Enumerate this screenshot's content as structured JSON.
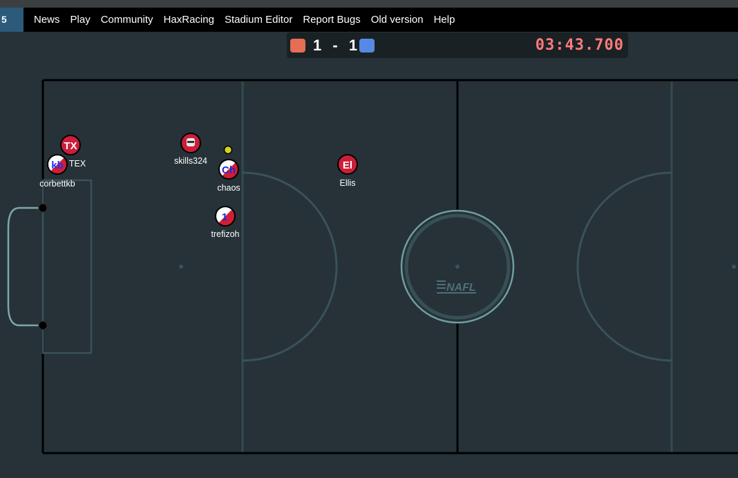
{
  "nav": {
    "logo": "5",
    "links": [
      "News",
      "Play",
      "Community",
      "HaxRacing",
      "Stadium Editor",
      "Report Bugs",
      "Old version",
      "Help"
    ]
  },
  "scoreboard": {
    "red_score": "1",
    "separator": "-",
    "blue_score": "1",
    "timer": "03:43.700",
    "red_color": "#e56e56",
    "blue_color": "#5689e5"
  },
  "stadium": {
    "logo_text": "NAFL",
    "background_color": "#263238",
    "line_color": "#000000"
  },
  "players": [
    {
      "name": "TEX",
      "avatar": "TX",
      "team": "red"
    },
    {
      "name": "corbettkb",
      "avatar": "kb",
      "team": "blue"
    },
    {
      "name": "skills324",
      "avatar": "face-icon",
      "team": "red"
    },
    {
      "name": "chaos",
      "avatar": "Ch",
      "team": "blue"
    },
    {
      "name": "trefizoh",
      "avatar": "1",
      "team": "blue"
    },
    {
      "name": "Ellis",
      "avatar": "El",
      "team": "red"
    }
  ],
  "ball": {
    "color": "#d4d41c"
  }
}
